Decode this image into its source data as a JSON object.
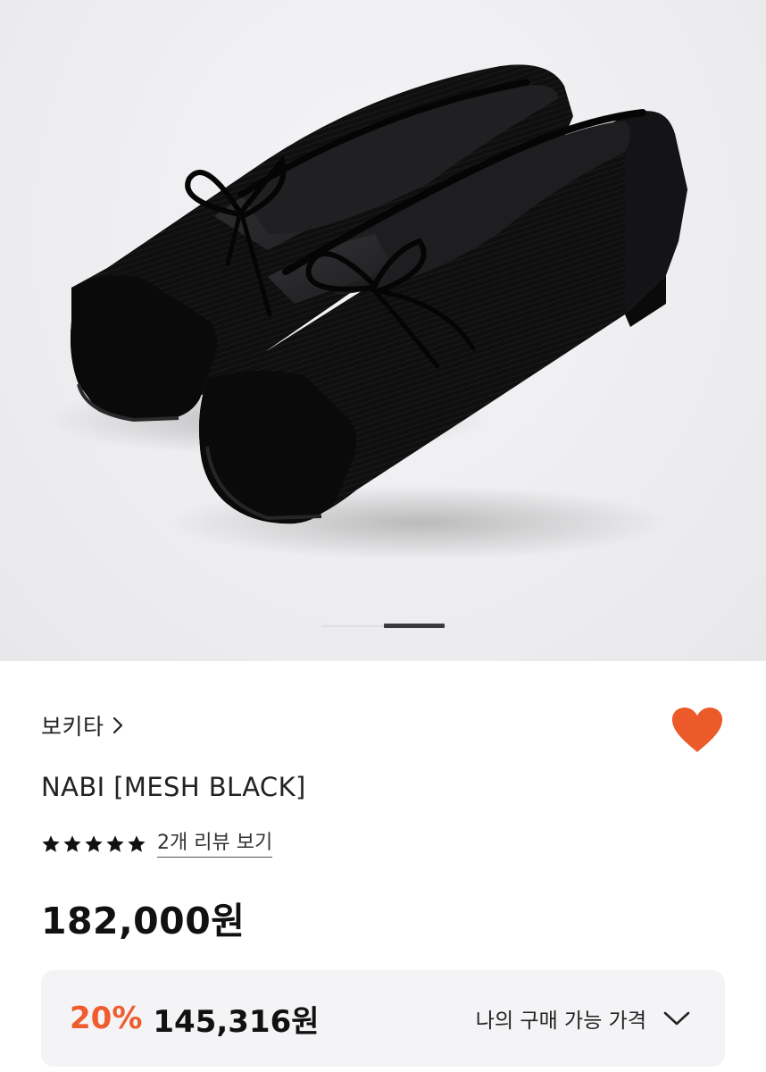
{
  "gallery": {
    "image_alt": "NABI [MESH BLACK] black mesh square-toe ballet flats with bow",
    "page_indicator": {
      "current": 2,
      "total": 2
    }
  },
  "product": {
    "brand": "보키타",
    "name": "NABI [MESH BLACK]",
    "rating": {
      "stars": 5,
      "review_link": "2개 리뷰 보기"
    },
    "price": "182,000원",
    "wishlisted": true
  },
  "deal": {
    "discount": "20%",
    "price": "145,316원",
    "label": "나의 구매 가능 가격"
  },
  "icons": {
    "brand_chevron": "chevron-right-icon",
    "wish": "heart-icon",
    "rating": "star-icon",
    "deal_expand": "chevron-down-icon"
  },
  "colors": {
    "accent": "#ef5c2e",
    "heart": "#ec5a2a",
    "deal_bg": "#f4f4f6",
    "text": "#111111"
  }
}
